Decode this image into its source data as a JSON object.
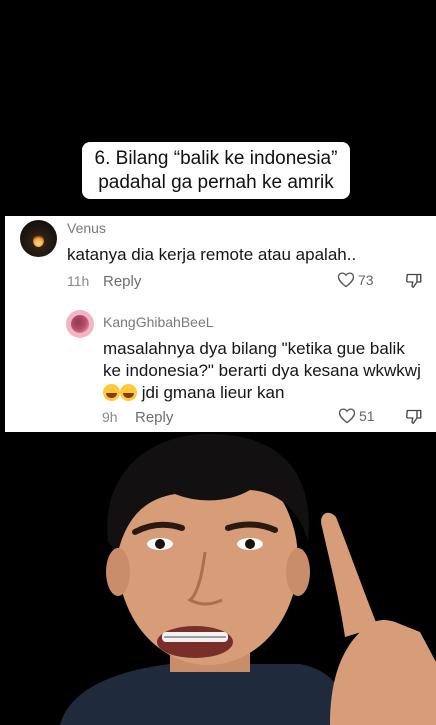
{
  "caption": {
    "line1": "6. Bilang “balik ke indonesia”",
    "line2": "padahal ga pernah ke amrik"
  },
  "comments": [
    {
      "username": "Venus",
      "text": "katanya dia kerja remote atau apalah..",
      "time": "11h",
      "reply_label": "Reply",
      "likes": "73"
    },
    {
      "username": "KangGhibahBeeL",
      "text_part1": "masalahnya dya bilang \"ketika gue balik ke indonesia?\" berarti dya kesana wkwkwj",
      "text_part2": " jdi gmana lieur kan",
      "time": "9h",
      "reply_label": "Reply",
      "likes": "51"
    }
  ]
}
